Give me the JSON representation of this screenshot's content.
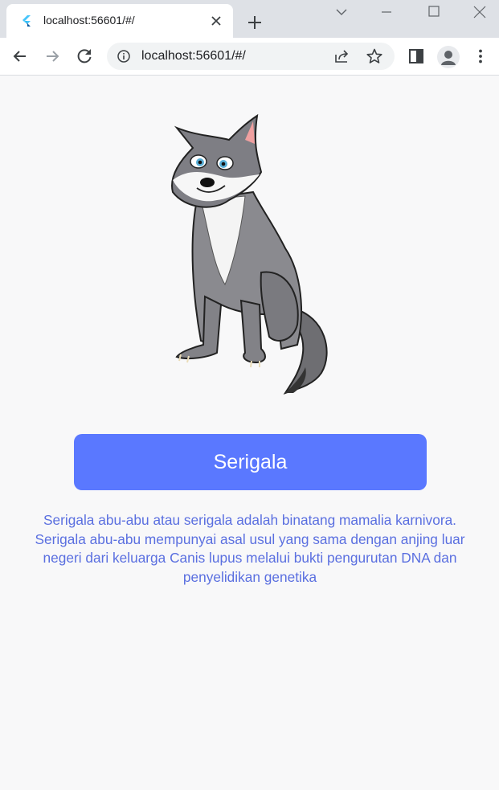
{
  "browser": {
    "tab_title": "localhost:56601/#/",
    "url": "localhost:56601/#/"
  },
  "page": {
    "animal_name": "Serigala",
    "description": "Serigala abu-abu atau serigala adalah binatang mamalia karnivora. Serigala abu-abu mempunyai asal usul yang sama dengan anjing luar negeri dari keluarga Canis lupus melalui bukti pengurutan DNA dan penyelidikan genetika",
    "image_icon": "wolf-illustration"
  },
  "colors": {
    "accent": "#5a78ff",
    "description_text": "#5a6fe0",
    "background": "#f8f8f9"
  }
}
